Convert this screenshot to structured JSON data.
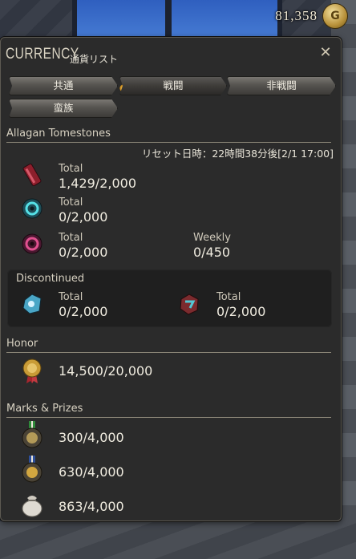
{
  "gil": {
    "amount": "81,358",
    "icon": "gil-coin-icon"
  },
  "window": {
    "title": "CURRENCY",
    "subtitle": "通貨リスト",
    "close_icon": "crossed-tools-icon"
  },
  "tabs": [
    {
      "label": "共通",
      "active": false
    },
    {
      "label": "戦闘",
      "active": true
    },
    {
      "label": "非戦闘",
      "active": false
    },
    {
      "label": "蛮族",
      "active": false
    }
  ],
  "tomestones": {
    "header": "Allagan Tomestones",
    "reset": "リセット日時：22時間38分後[2/1 17:00]",
    "items": [
      {
        "icon": "red-tomestone-icon",
        "label": "Total",
        "value": "1,429/2,000"
      },
      {
        "icon": "teal-tomestone-icon",
        "label": "Total",
        "value": "0/2,000"
      },
      {
        "icon": "pink-tomestone-icon",
        "label": "Total",
        "value": "0/2,000",
        "weekly_label": "Weekly",
        "weekly_value": "0/450"
      }
    ],
    "discontinued": {
      "header": "Discontinued",
      "items": [
        {
          "icon": "blue-tomestone-icon",
          "label": "Total",
          "value": "0/2,000"
        },
        {
          "icon": "crimson-tomestone-icon",
          "label": "Total",
          "value": "0/2,000"
        }
      ]
    }
  },
  "honor": {
    "header": "Honor",
    "items": [
      {
        "icon": "gold-medal-icon",
        "value": "14,500/20,000"
      }
    ]
  },
  "marks": {
    "header": "Marks & Prizes",
    "items": [
      {
        "icon": "green-ribbon-medal-icon",
        "value": "300/4,000"
      },
      {
        "icon": "blue-ribbon-medal-icon",
        "value": "630/4,000"
      },
      {
        "icon": "gil-bag-icon",
        "value": "863/4,000"
      }
    ]
  }
}
